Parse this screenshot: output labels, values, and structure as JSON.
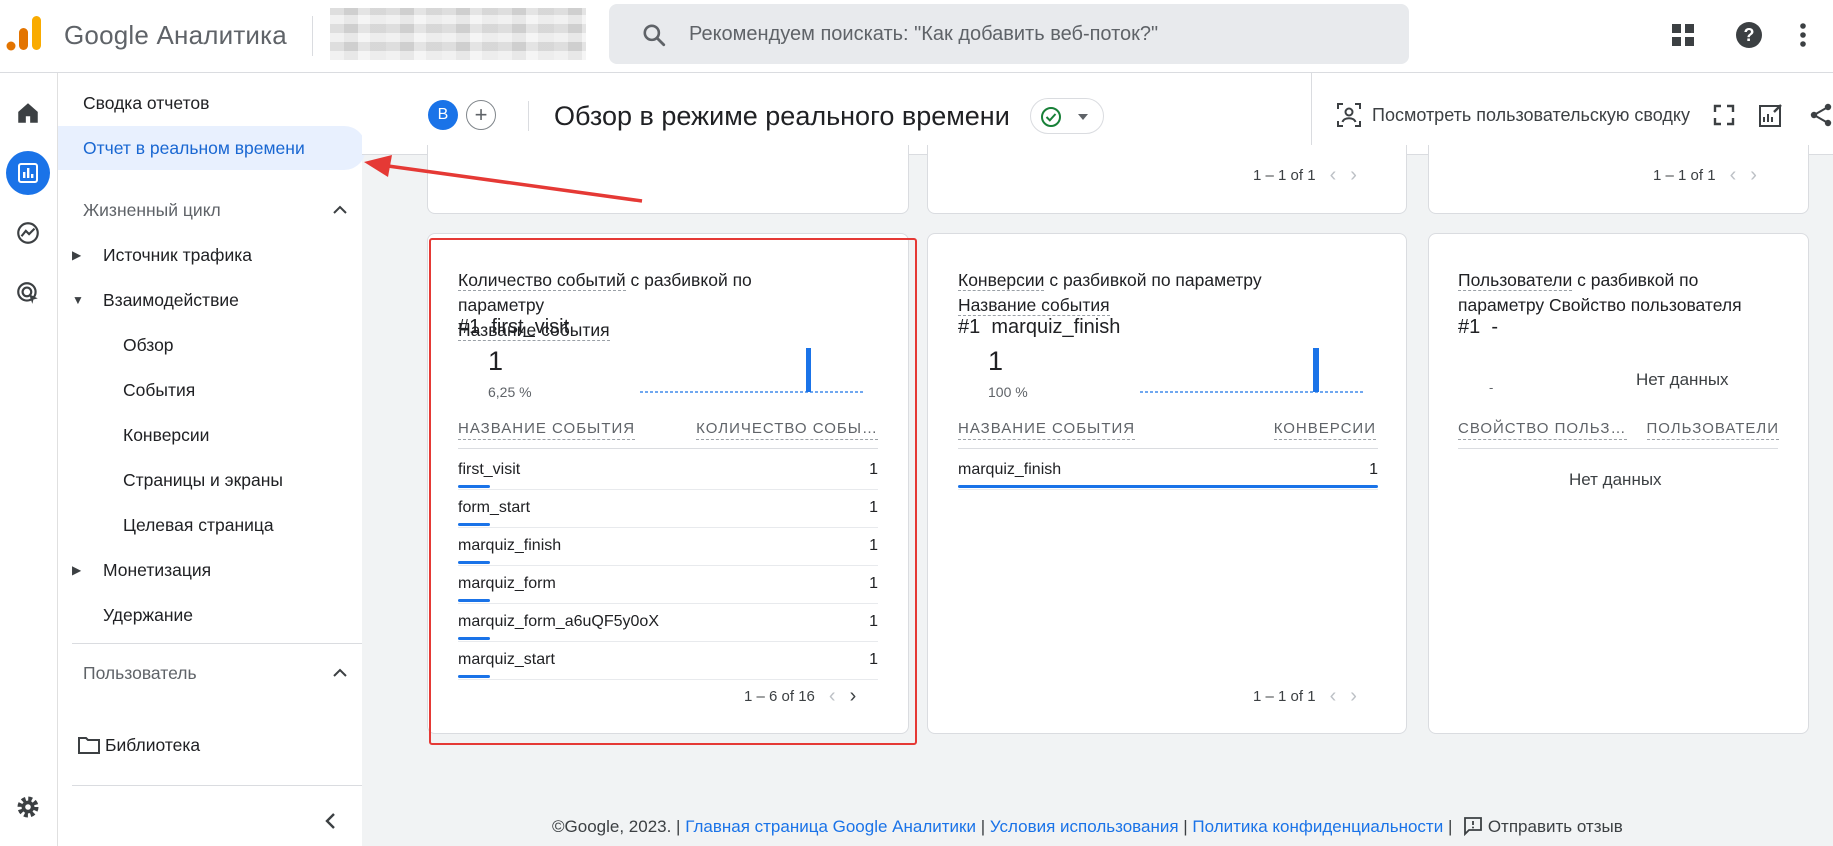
{
  "app": {
    "name": "Google Аналитика"
  },
  "search": {
    "placeholder": "Рекомендуем поискать: \"Как добавить веб-поток?\""
  },
  "topbar_icons": [
    "apps-grid-icon",
    "help-icon",
    "more-vert-icon"
  ],
  "nav": {
    "report_summary": "Сводка отчетов",
    "realtime": "Отчет в реальном времени",
    "lifecycle": "Жизненный цикл",
    "acquisition": "Источник трафика",
    "engagement": "Взаимодействие",
    "overview": "Обзор",
    "events": "События",
    "conversions": "Конверсии",
    "pages_screens": "Страницы и экраны",
    "landing_page": "Целевая страница",
    "monetization": "Монетизация",
    "retention": "Удержание",
    "user": "Пользователь",
    "library": "Библиотека"
  },
  "header": {
    "comparison_avatar": "B",
    "title": "Обзор в режиме реального времени",
    "view_snapshot": "Посмотреть пользовательскую сводку"
  },
  "top_pagers": [
    "1 – 1 of 1",
    "1 – 1 of 1"
  ],
  "cards": [
    {
      "title_metric": "Количество событий",
      "title_mid": " с разбивкой по параметру ",
      "title_dim": "Название события",
      "rank": "#1",
      "rank_value": "first_visit",
      "value": "1",
      "pct": "6,25 %",
      "col_dim": "НАЗВАНИЕ СОБЫТИЯ",
      "col_metric": "КОЛИЧЕСТВО СОБЫ…",
      "rows": [
        {
          "name": "first_visit",
          "value": "1",
          "bar": 0.075
        },
        {
          "name": "form_start",
          "value": "1",
          "bar": 0.075
        },
        {
          "name": "marquiz_finish",
          "value": "1",
          "bar": 0.075
        },
        {
          "name": "marquiz_form",
          "value": "1",
          "bar": 0.075
        },
        {
          "name": "marquiz_form_a6uQF5y0oX",
          "value": "1",
          "bar": 0.075
        },
        {
          "name": "marquiz_start",
          "value": "1",
          "bar": 0.075
        }
      ],
      "pager": "1 – 6 of 16"
    },
    {
      "title_metric": "Конверсии",
      "title_mid": " с разбивкой по параметру ",
      "title_dim": "Название события",
      "rank": "#1",
      "rank_value": "marquiz_finish",
      "value": "1",
      "pct": "100 %",
      "col_dim": "НАЗВАНИЕ СОБЫТИЯ",
      "col_metric": "КОНВЕРСИИ",
      "rows": [
        {
          "name": "marquiz_finish",
          "value": "1",
          "bar": 1.0
        }
      ],
      "pager": "1 – 1 of 1"
    },
    {
      "title_metric": "Пользователи",
      "title_mid": " с разбивкой по параметру Свойство пользователя",
      "title_dim": "",
      "rank": "#1",
      "rank_value": "-",
      "value": "-",
      "no_data": "Нет данных",
      "col_dim": "СВОЙСТВО ПОЛЬЗ…",
      "col_metric": "ПОЛЬЗОВАТЕЛИ",
      "table_no_data": "Нет данных"
    }
  ],
  "footer": {
    "copyright": "©Google, 2023. | ",
    "home_link": "Главная страница Google Аналитики",
    "terms_link": "Условия использования",
    "privacy_link": "Политика конфиденциальности",
    "feedback": "Отправить отзыв"
  },
  "colors": {
    "accent": "#1a73e8",
    "highlight": "#e53935",
    "success": "#188038"
  }
}
